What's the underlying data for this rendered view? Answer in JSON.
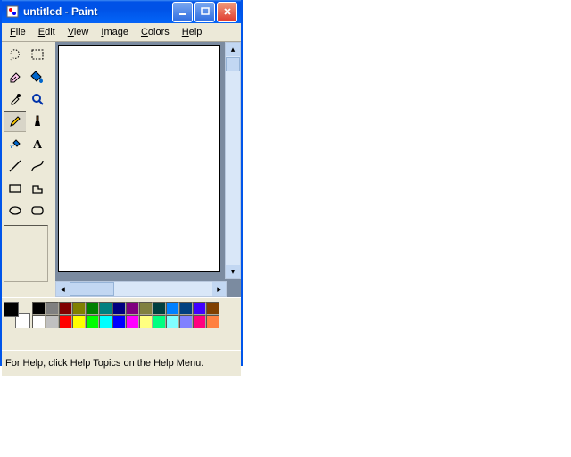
{
  "window": {
    "title": "untitled - Paint"
  },
  "menu": {
    "file": "File",
    "edit": "Edit",
    "view": "View",
    "image": "Image",
    "colors": "Colors",
    "help": "Help"
  },
  "tools": [
    {
      "name": "free-select-tool"
    },
    {
      "name": "rect-select-tool"
    },
    {
      "name": "eraser-tool"
    },
    {
      "name": "fill-tool"
    },
    {
      "name": "pick-color-tool"
    },
    {
      "name": "magnifier-tool"
    },
    {
      "name": "pencil-tool",
      "selected": true
    },
    {
      "name": "brush-tool"
    },
    {
      "name": "airbrush-tool"
    },
    {
      "name": "text-tool"
    },
    {
      "name": "line-tool"
    },
    {
      "name": "curve-tool"
    },
    {
      "name": "rectangle-tool"
    },
    {
      "name": "polygon-tool"
    },
    {
      "name": "ellipse-tool"
    },
    {
      "name": "round-rect-tool"
    }
  ],
  "palette": {
    "foreground": "#000000",
    "background": "#ffffff",
    "colors": [
      "#000000",
      "#808080",
      "#800000",
      "#808000",
      "#008000",
      "#008080",
      "#000080",
      "#800080",
      "#808040",
      "#004040",
      "#0080ff",
      "#004080",
      "#4000ff",
      "#804000",
      "#ffffff",
      "#c0c0c0",
      "#ff0000",
      "#ffff00",
      "#00ff00",
      "#00ffff",
      "#0000ff",
      "#ff00ff",
      "#ffff80",
      "#00ff80",
      "#80ffff",
      "#8080ff",
      "#ff0080",
      "#ff8040"
    ]
  },
  "status": {
    "text": "For Help, click Help Topics on the Help Menu."
  }
}
